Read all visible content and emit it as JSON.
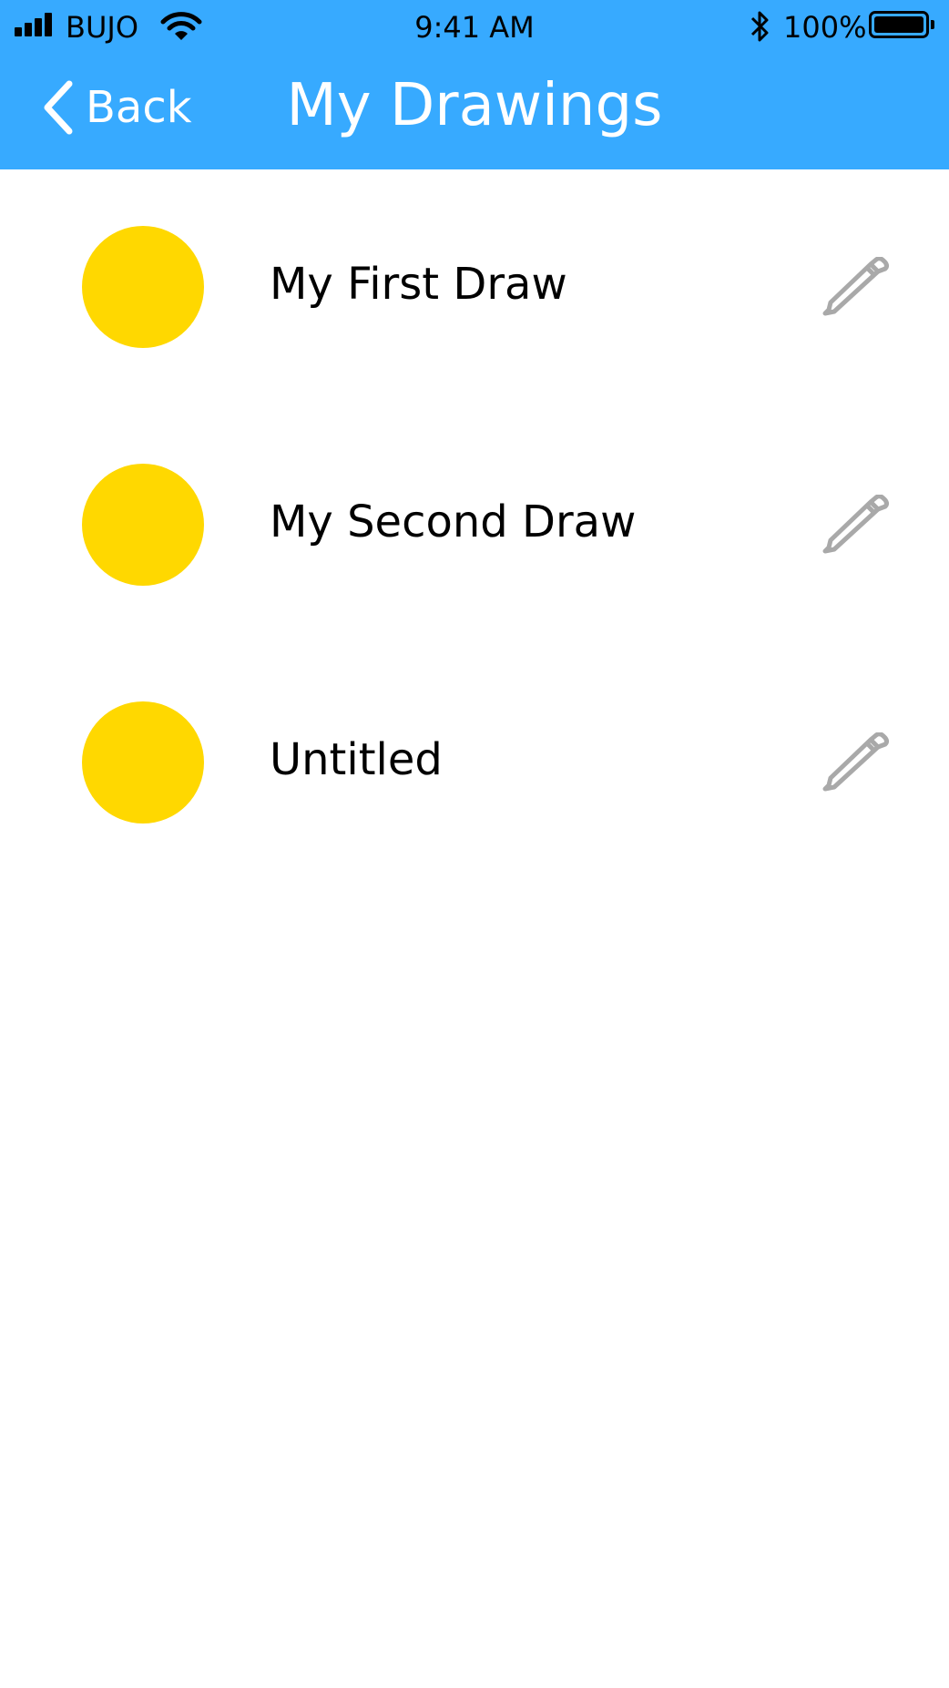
{
  "status_bar": {
    "carrier": "BUJO",
    "time": "9:41 AM",
    "battery_percent": "100%"
  },
  "nav": {
    "back_label": "Back",
    "title": "My Drawings"
  },
  "drawings": [
    {
      "name": "My First Draw"
    },
    {
      "name": "My Second Draw"
    },
    {
      "name": "Untitled"
    }
  ],
  "colors": {
    "header": "#37aaff",
    "thumbnail": "#ffd800",
    "edit_icon": "#a9a9a9"
  },
  "icons": {
    "back": "chevron-left-icon",
    "edit": "pencil-icon"
  }
}
